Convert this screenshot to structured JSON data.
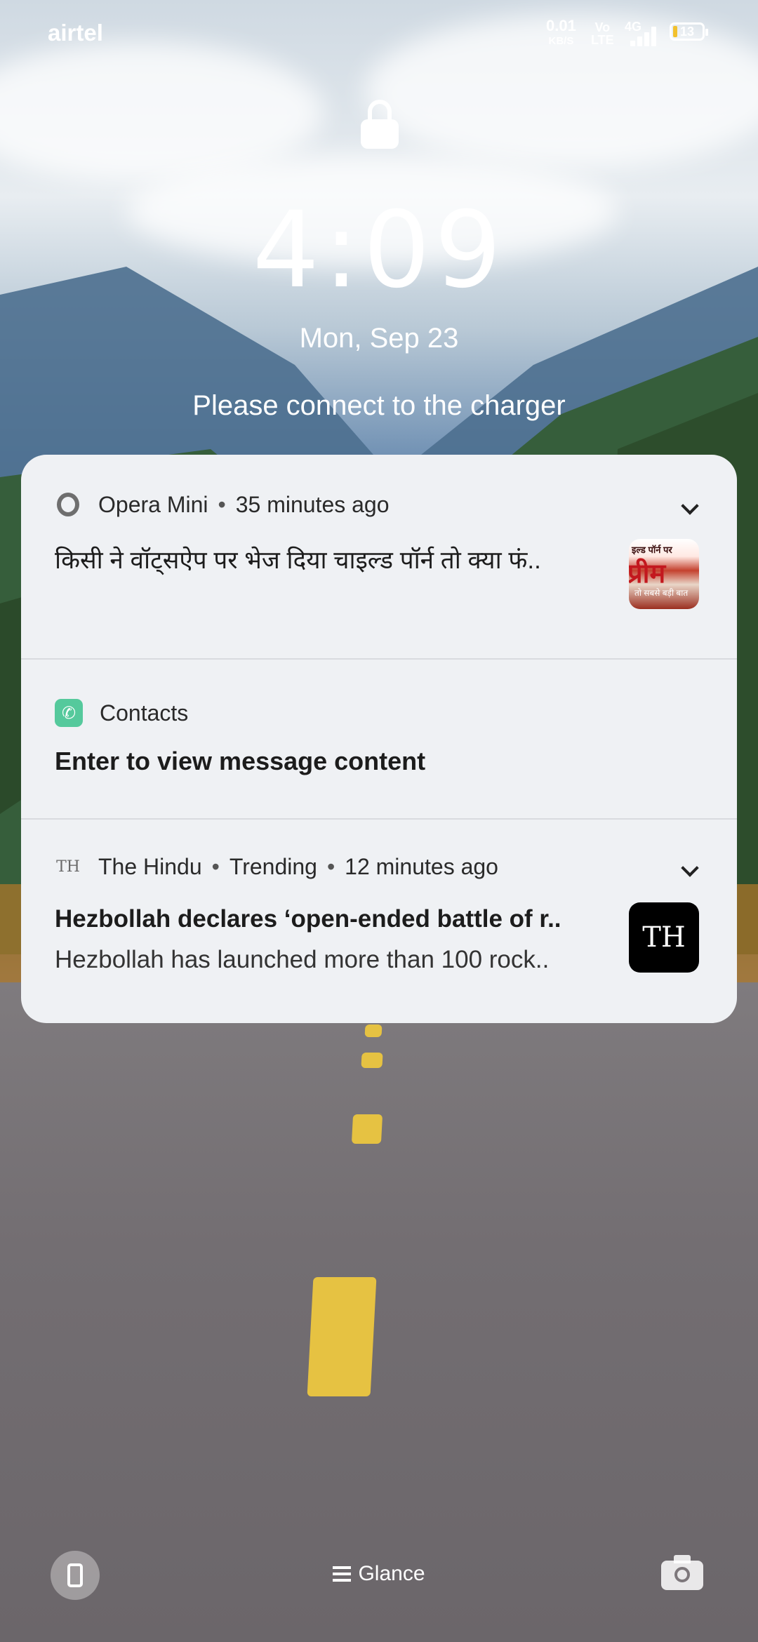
{
  "status_bar": {
    "carrier": "airtel",
    "speed_value": "0.01",
    "speed_unit": "KB/S",
    "volte_top": "Vo",
    "volte_bottom": "LTE",
    "network": "4G",
    "battery": "13"
  },
  "lock_screen": {
    "time": "4:09",
    "date": "Mon, Sep 23",
    "charge_message": "Please connect to the charger"
  },
  "notifications": [
    {
      "app": "Opera Mini",
      "time": "35 minutes ago",
      "title": "किसी ने वॉट्सऐप पर भेज दिया चाइल्ड पॉर्न तो क्या फं..",
      "thumb_line1": "इल्ड पॉर्न पर",
      "thumb_line2": "प्रीम",
      "thumb_line3": "तो सबसे बड़ी बात"
    },
    {
      "app": "Contacts",
      "title": "Enter to view message content"
    },
    {
      "app": "The Hindu",
      "category": "Trending",
      "time": "12 minutes ago",
      "app_icon_text": "TH",
      "title": "Hezbollah declares ‘open-ended battle of r..",
      "subtitle": "Hezbollah has launched more than 100 rock..",
      "thumb_text": "TH"
    }
  ],
  "bottom_bar": {
    "glance_label": "Glance"
  }
}
